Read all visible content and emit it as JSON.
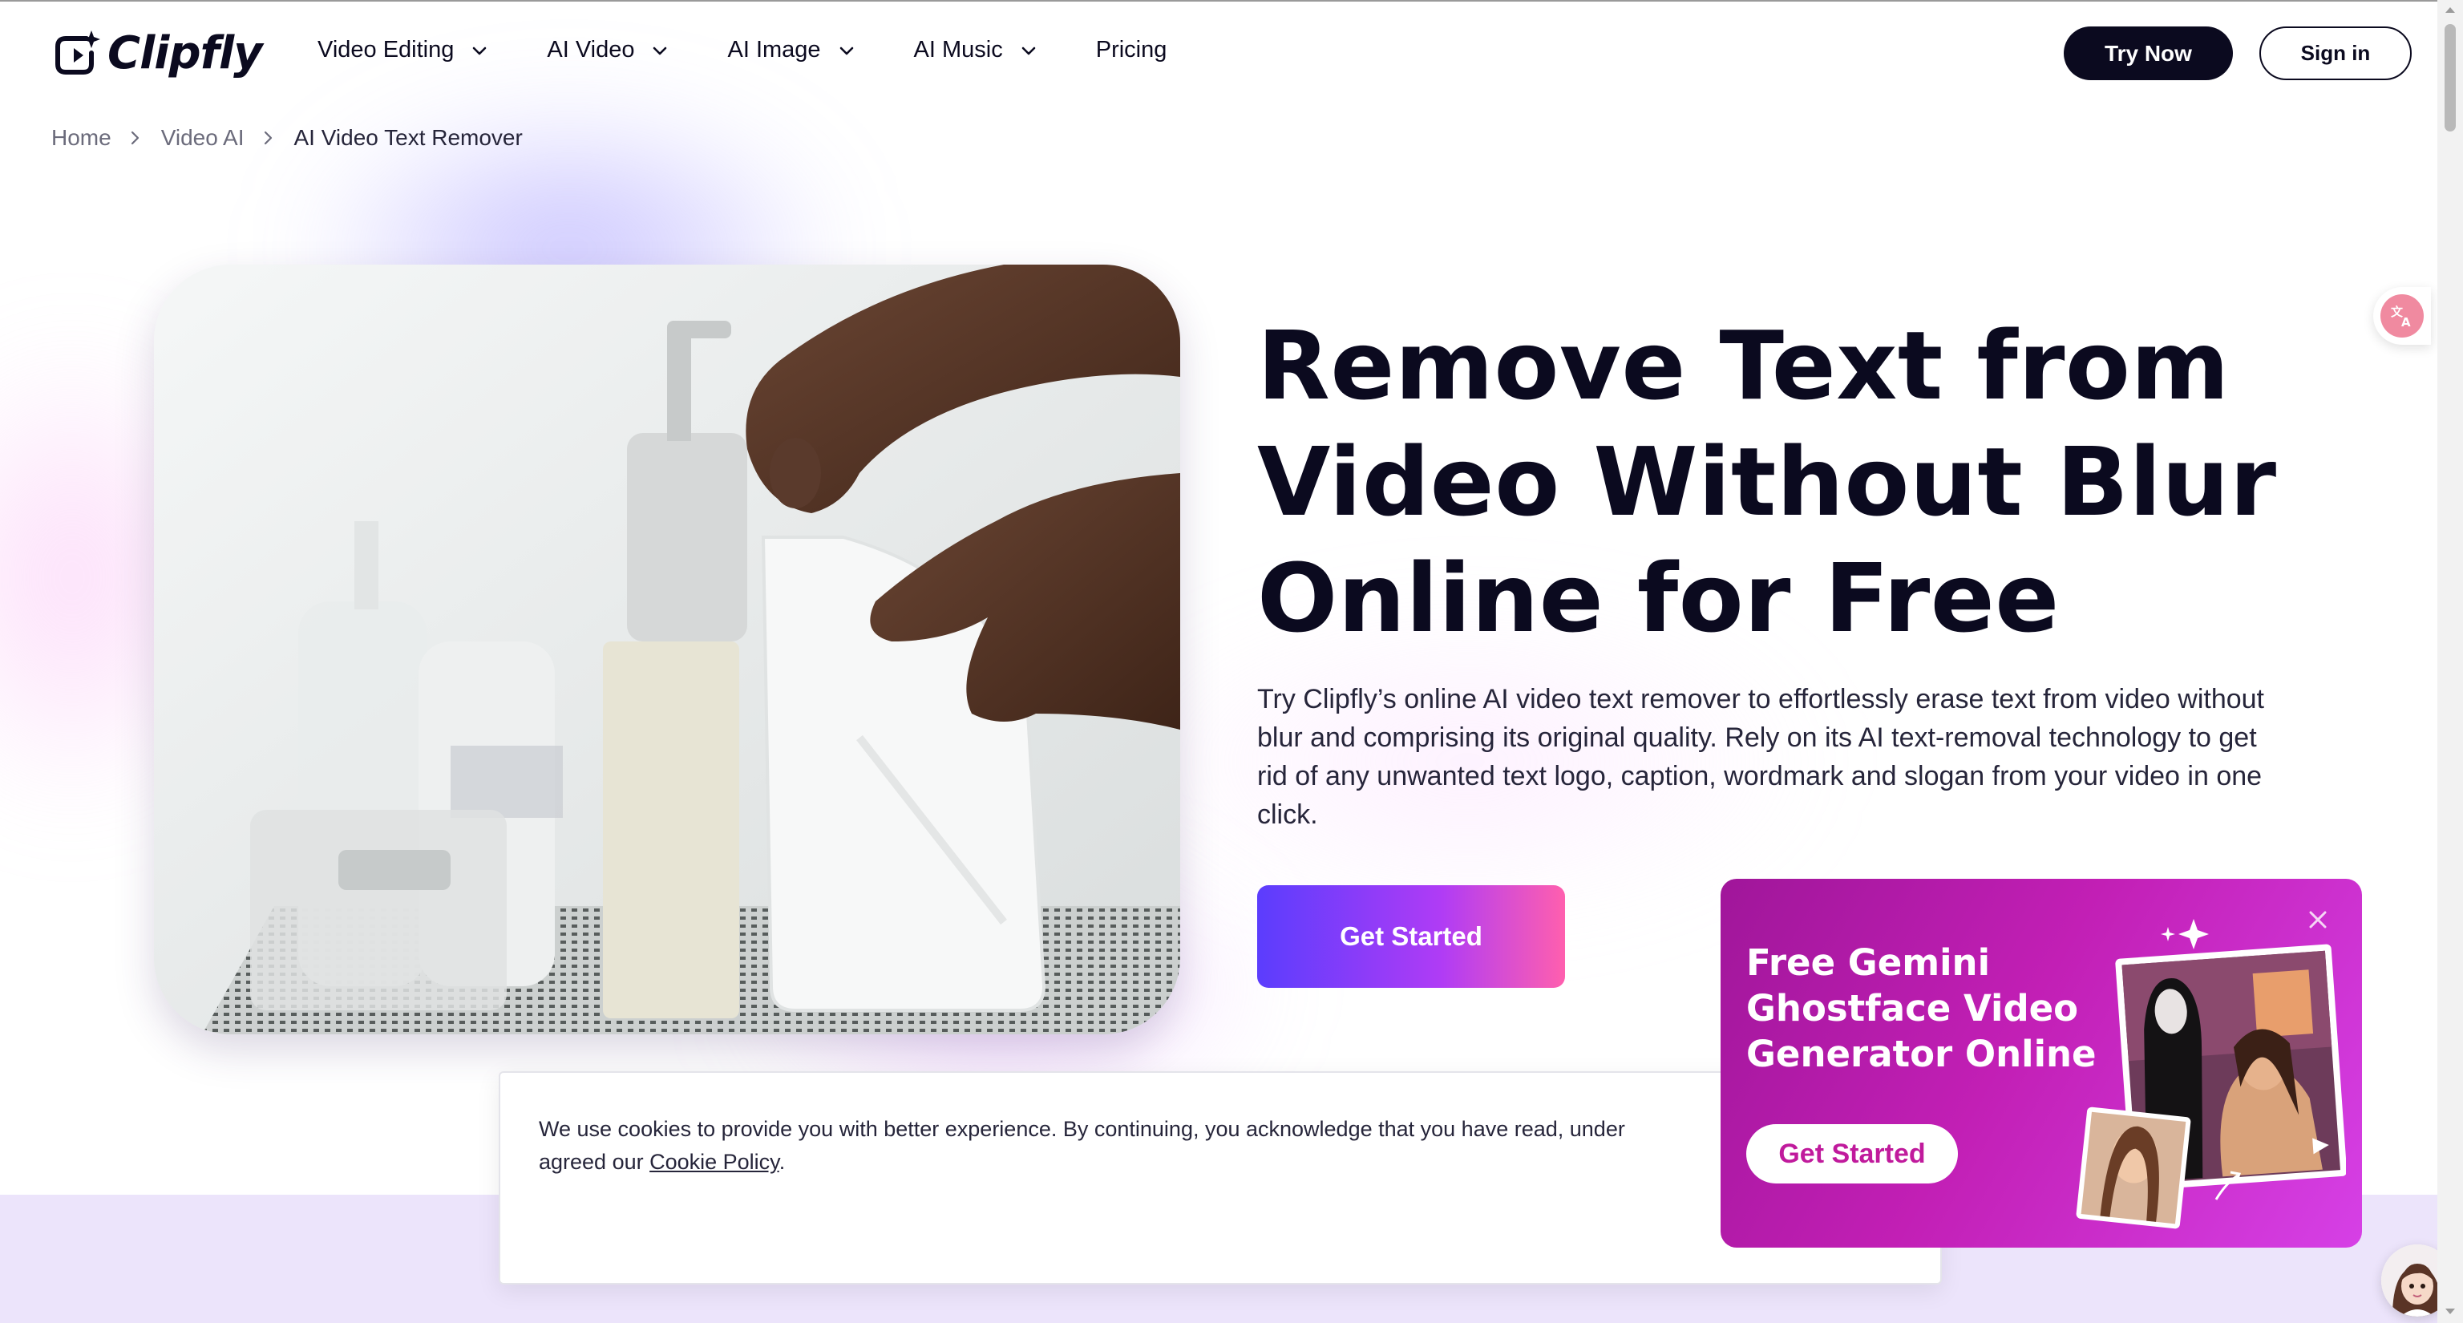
{
  "brand": {
    "name": "Clipfly"
  },
  "nav": {
    "items": [
      {
        "label": "Video Editing",
        "has_dropdown": true
      },
      {
        "label": "AI Video",
        "has_dropdown": true
      },
      {
        "label": "AI Image",
        "has_dropdown": true
      },
      {
        "label": "AI Music",
        "has_dropdown": true
      },
      {
        "label": "Pricing",
        "has_dropdown": false
      }
    ],
    "try_now": "Try Now",
    "sign_in": "Sign in"
  },
  "breadcrumb": {
    "items": [
      "Home",
      "Video AI",
      "AI Video Text Remover"
    ]
  },
  "hero": {
    "title_lines": [
      "Remove Text from",
      "Video Without Blur",
      "Online for Free"
    ],
    "description": "Try Clipfly’s online AI video text remover to effortlessly erase text from video without blur and comprising its original quality. Rely on its AI text-removal technology to get rid of any unwanted text logo, caption, wordmark and slogan from your video in one click.",
    "cta": "Get Started"
  },
  "cookie": {
    "text_before_link": "We use cookies to provide you with better experience. By continuing, you acknowledge that you have read, under",
    "text_line2_before": "agreed our ",
    "link": "Cookie Policy",
    "text_after_link": "."
  },
  "promo": {
    "title_lines": [
      "Free Gemini",
      "Ghostface Video",
      "Generator Online"
    ],
    "cta": "Get Started"
  },
  "icons": {
    "logo": "clipfly-logo-icon",
    "dropdown": "chevron-down-icon",
    "breadcrumb_sep": "chevron-right-icon",
    "translate": "translate-icon",
    "close": "close-icon",
    "assistant": "assistant-avatar-icon"
  },
  "colors": {
    "primary_dark": "#0b0a1f",
    "cta_gradient_start": "#5b3dfd",
    "cta_gradient_end": "#ff5fae",
    "promo_bg": "#c21fb5",
    "band_bg": "#ece4fb"
  }
}
